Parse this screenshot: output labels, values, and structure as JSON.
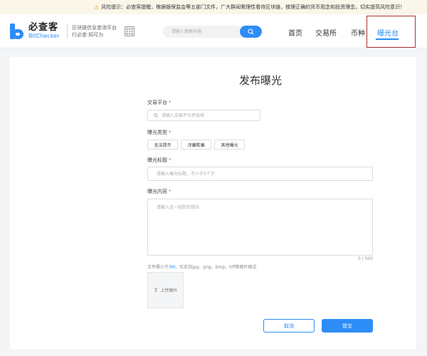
{
  "risk_banner": {
    "label": "风险提示：",
    "text": "必查客提醒，根据银保监会等五部门文件，广大群闻需理性看待区块链，梳理正确的货币观念和投资理念，切实提高风险意识！"
  },
  "header": {
    "logo_cn": "必查客",
    "logo_en": "BitChecker",
    "slogan_line1": "区块链信息查询平台",
    "slogan_line2": "行必查·知可为",
    "search_placeholder": "请输入搜索内容",
    "nav": {
      "home": "首页",
      "exchange": "交易所",
      "coin": "币种",
      "exposure": "曝光台"
    }
  },
  "form": {
    "title": "发布曝光",
    "platform": {
      "label": "交易平台",
      "required": "*",
      "placeholder": "请输入交易平台并选择"
    },
    "type": {
      "label": "曝光类型",
      "required": "*",
      "options": [
        "无法提币",
        "涉嫌欺骗",
        "其他曝光"
      ]
    },
    "title_field": {
      "label": "曝光标题",
      "required": "*",
      "placeholder": "请输入曝光标题，不少于5个字"
    },
    "content": {
      "label": "曝光内容",
      "required": "*",
      "placeholder": "请输入这一刻您的想法",
      "count": "0 / 500"
    },
    "file_hint": {
      "prefix": "文件需小于",
      "size": "3M",
      "suffix": "，仅支持jpg、png、bmp、tiff等图片格式"
    },
    "upload_label": "上传图片",
    "cancel": "取消",
    "submit": "提交"
  }
}
